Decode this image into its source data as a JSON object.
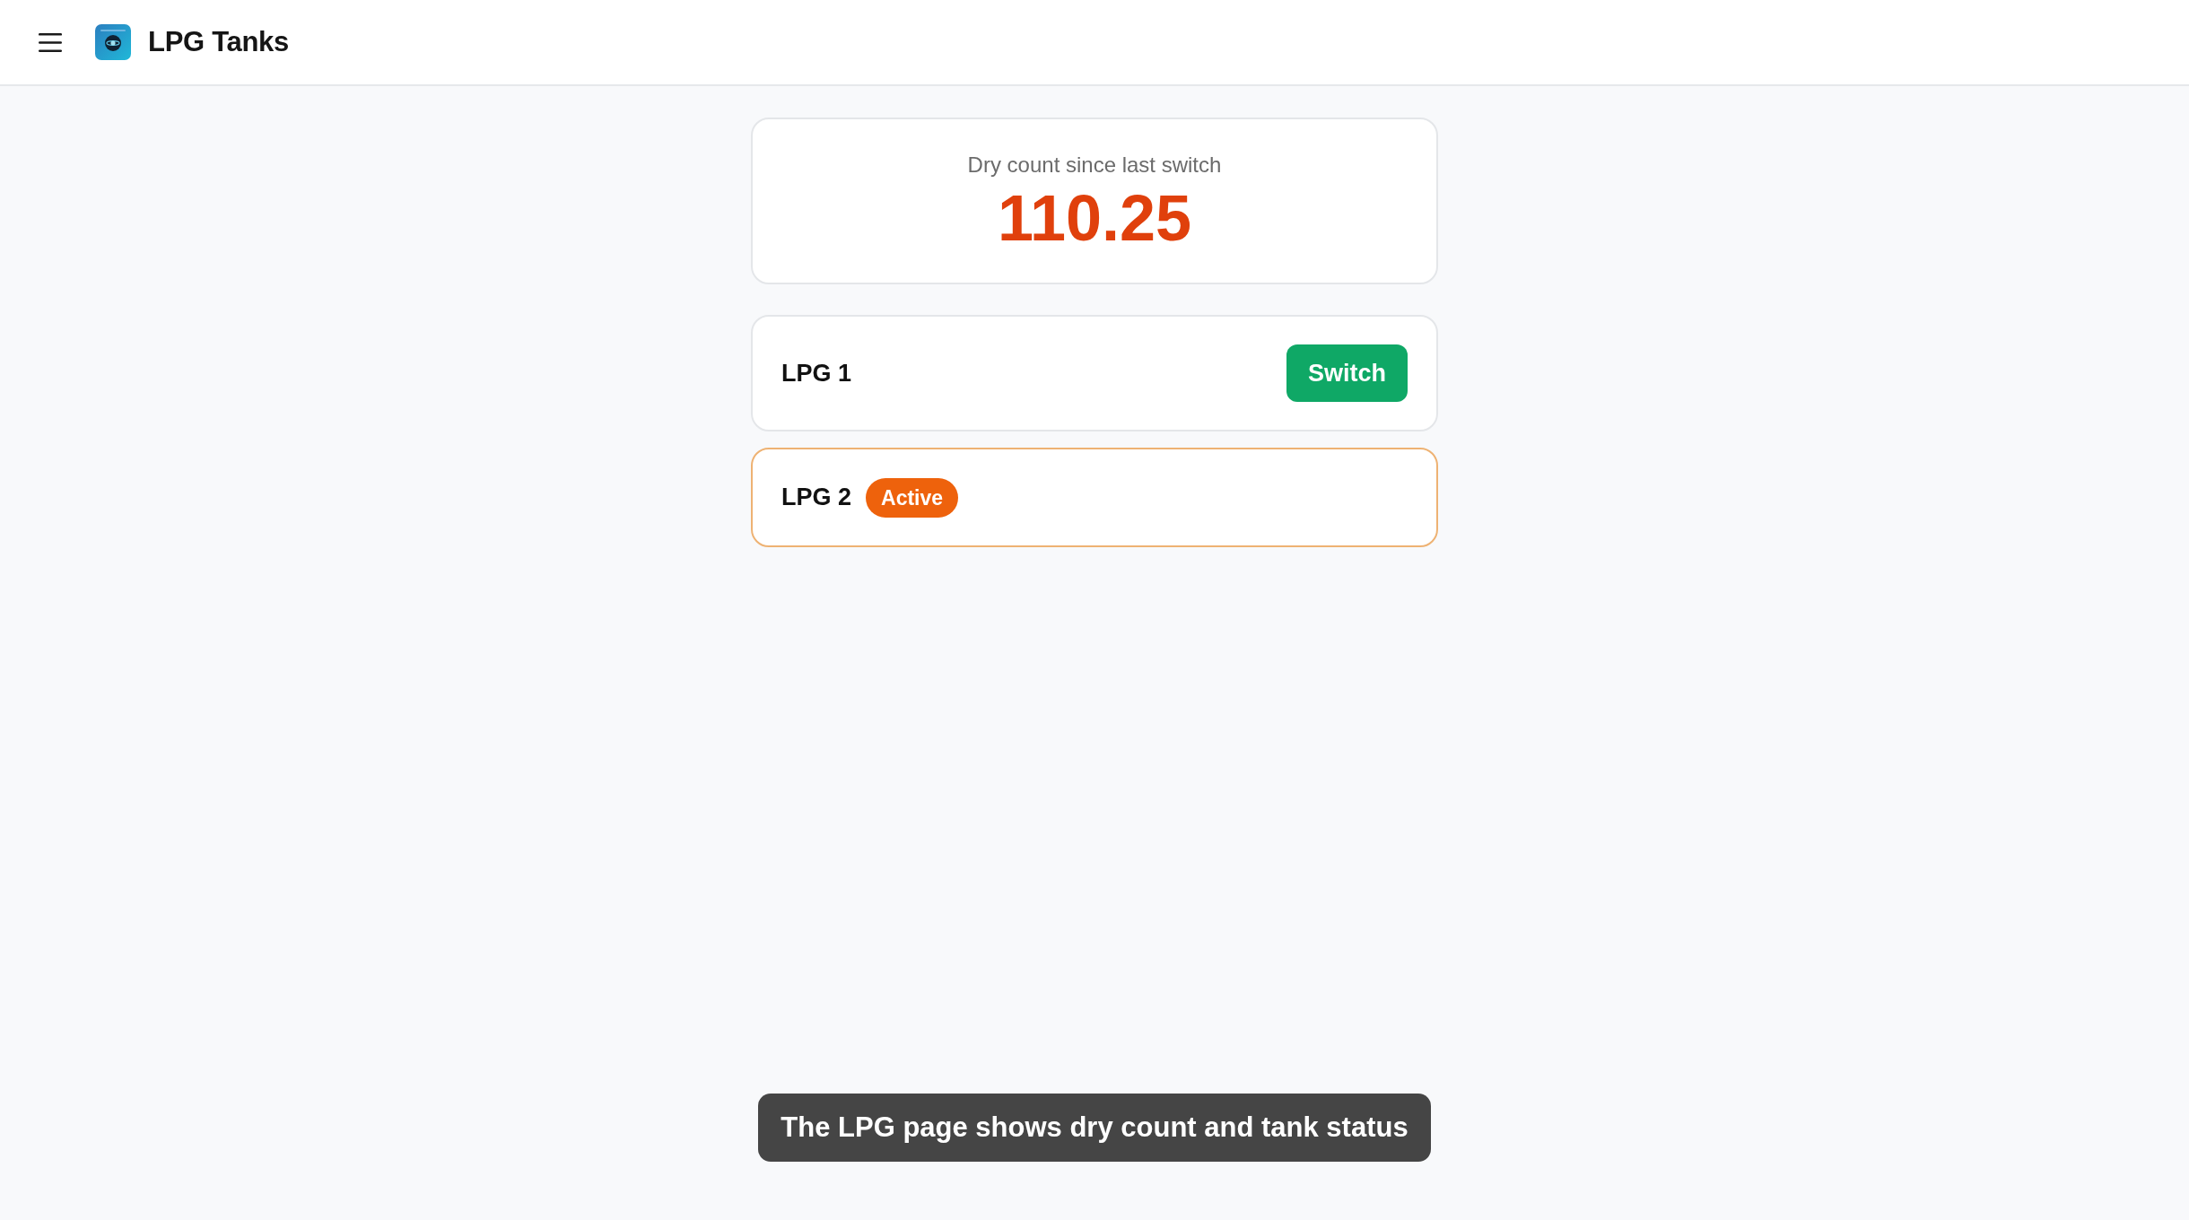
{
  "header": {
    "title": "LPG Tanks"
  },
  "dry_count": {
    "label": "Dry count since last switch",
    "value": "110.25"
  },
  "tanks": [
    {
      "name": "LPG 1",
      "active": false,
      "action": "Switch"
    },
    {
      "name": "LPG 2",
      "active": true,
      "badge": "Active"
    }
  ],
  "toast": {
    "message": "The LPG page shows dry count and tank status"
  }
}
